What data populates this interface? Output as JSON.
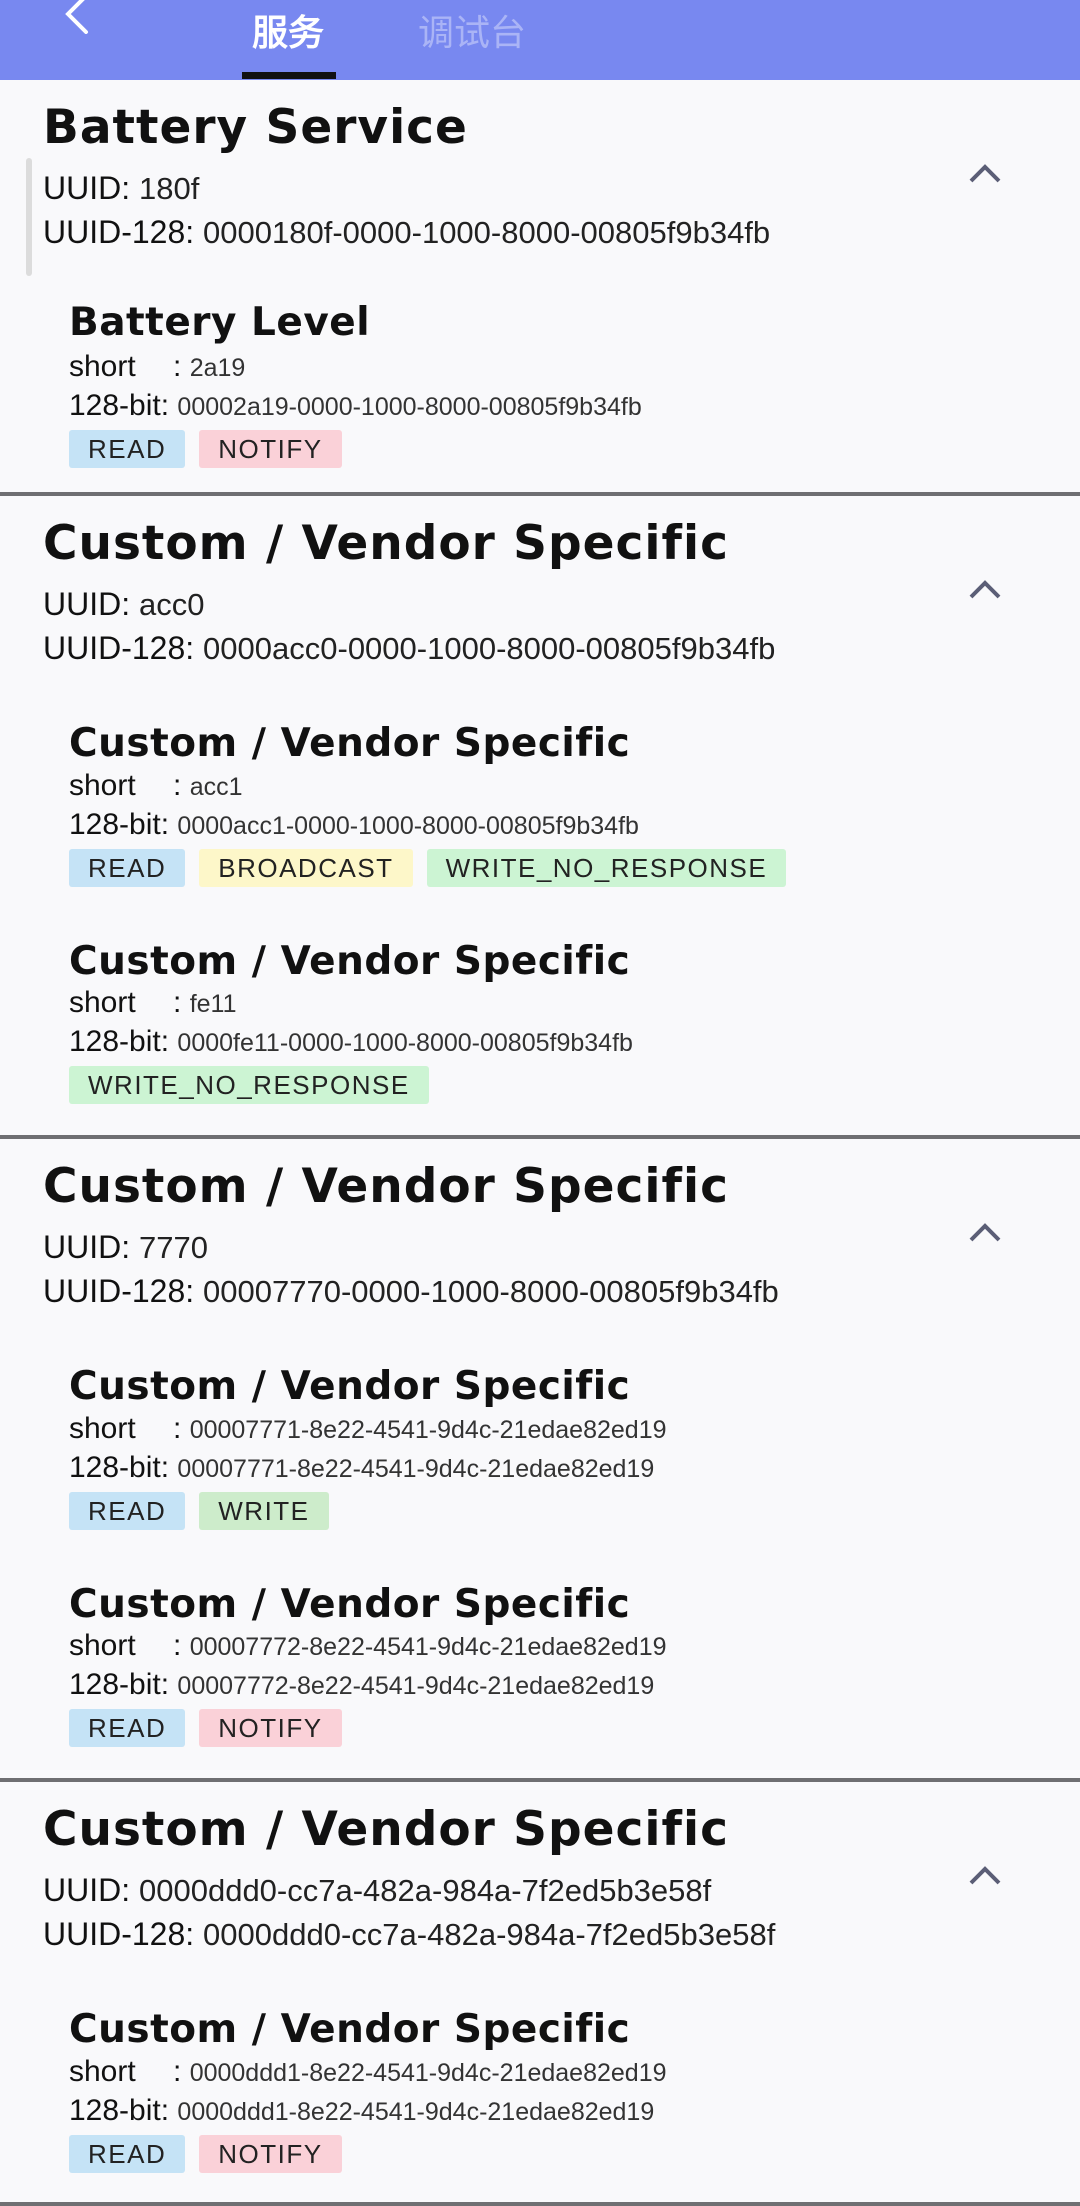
{
  "tabs": {
    "services": "服务",
    "console": "调试台"
  },
  "labels": {
    "uuid": "UUID:",
    "uuid128": "UUID-128:",
    "short": "short",
    "colon": ":",
    "bit128": "128-bit:"
  },
  "services": [
    {
      "name": "Battery Service",
      "uuid": "180f",
      "uuid128": "0000180f-0000-1000-8000-00805f9b34fb",
      "characteristics": [
        {
          "name": "Battery Level",
          "short": "2a19",
          "bit128": "00002a19-0000-1000-8000-00805f9b34fb",
          "props": [
            "READ",
            "NOTIFY"
          ]
        }
      ]
    },
    {
      "name": "Custom / Vendor Specific",
      "uuid": "acc0",
      "uuid128": "0000acc0-0000-1000-8000-00805f9b34fb",
      "characteristics": [
        {
          "name": "Custom / Vendor Specific",
          "short": "acc1",
          "bit128": "0000acc1-0000-1000-8000-00805f9b34fb",
          "props": [
            "READ",
            "BROADCAST",
            "WRITE_NO_RESPONSE"
          ]
        },
        {
          "name": "Custom / Vendor Specific",
          "short": "fe11",
          "bit128": "0000fe11-0000-1000-8000-00805f9b34fb",
          "props": [
            "WRITE_NO_RESPONSE"
          ]
        }
      ]
    },
    {
      "name": "Custom / Vendor Specific",
      "uuid": "7770",
      "uuid128": "00007770-0000-1000-8000-00805f9b34fb",
      "characteristics": [
        {
          "name": "Custom / Vendor Specific",
          "short": "00007771-8e22-4541-9d4c-21edae82ed19",
          "bit128": "00007771-8e22-4541-9d4c-21edae82ed19",
          "props": [
            "READ",
            "WRITE"
          ]
        },
        {
          "name": "Custom / Vendor Specific",
          "short": "00007772-8e22-4541-9d4c-21edae82ed19",
          "bit128": "00007772-8e22-4541-9d4c-21edae82ed19",
          "props": [
            "READ",
            "NOTIFY"
          ]
        }
      ]
    },
    {
      "name": "Custom / Vendor Specific",
      "uuid": "0000ddd0-cc7a-482a-984a-7f2ed5b3e58f",
      "uuid128": "0000ddd0-cc7a-482a-984a-7f2ed5b3e58f",
      "characteristics": [
        {
          "name": "Custom / Vendor Specific",
          "short": "0000ddd1-8e22-4541-9d4c-21edae82ed19",
          "bit128": "0000ddd1-8e22-4541-9d4c-21edae82ed19",
          "props": [
            "READ",
            "NOTIFY"
          ]
        }
      ]
    }
  ]
}
